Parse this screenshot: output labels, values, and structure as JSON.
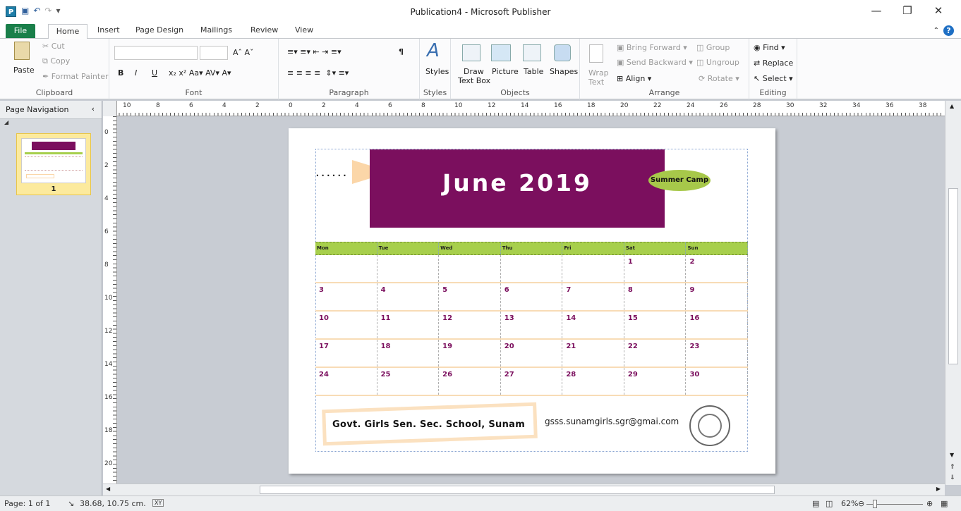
{
  "window": {
    "title": "Publication4  -  Microsoft Publisher",
    "app_icon": "P",
    "minimize": "—",
    "restore": "❐",
    "close": "✕"
  },
  "tabs": [
    "File",
    "Home",
    "Insert",
    "Page Design",
    "Mailings",
    "Review",
    "View"
  ],
  "ribbon": {
    "clipboard": {
      "paste": "Paste",
      "cut": "Cut",
      "copy": "Copy",
      "format_painter": "Format Painter",
      "label": "Clipboard"
    },
    "font": {
      "label": "Font",
      "bold": "B",
      "italic": "I",
      "underline": "U"
    },
    "paragraph": {
      "label": "Paragraph",
      "pilcrow": "¶"
    },
    "styles": {
      "styles": "Styles",
      "label": "Styles"
    },
    "objects": {
      "draw_text_box": "Draw",
      "draw_text_box2": "Text Box",
      "picture": "Picture",
      "table": "Table",
      "shapes": "Shapes",
      "label": "Objects"
    },
    "arrange": {
      "wrap_text": "Wrap",
      "wrap_text2": "Text",
      "bring_forward": "Bring Forward",
      "send_backward": "Send Backward",
      "align": "Align",
      "group": "Group",
      "ungroup": "Ungroup",
      "rotate": "Rotate",
      "label": "Arrange"
    },
    "editing": {
      "find": "Find",
      "replace": "Replace",
      "select": "Select",
      "label": "Editing"
    }
  },
  "page_nav": {
    "title": "Page Navigation",
    "page_number": "1"
  },
  "ruler_top": [
    "10",
    "8",
    "6",
    "4",
    "2",
    "0",
    "2",
    "4",
    "6",
    "8",
    "10",
    "12",
    "14",
    "16",
    "18",
    "20",
    "22",
    "24",
    "26",
    "28",
    "30",
    "32",
    "34",
    "36",
    "38"
  ],
  "ruler_left": [
    "0",
    "2",
    "4",
    "6",
    "8",
    "10",
    "12",
    "14",
    "16",
    "18",
    "20"
  ],
  "publication": {
    "banner_title": "June 2019",
    "badge": "Summer Camp",
    "dots": "......",
    "days": [
      "Mon",
      "Tue",
      "Wed",
      "Thu",
      "Fri",
      "Sat",
      "Sun"
    ],
    "weeks": [
      [
        "",
        "",
        "",
        "",
        "",
        "1",
        "2"
      ],
      [
        "3",
        "4",
        "5",
        "6",
        "7",
        "8",
        "9"
      ],
      [
        "10",
        "11",
        "12",
        "13",
        "14",
        "15",
        "16"
      ],
      [
        "17",
        "18",
        "19",
        "20",
        "21",
        "22",
        "23"
      ],
      [
        "24",
        "25",
        "26",
        "27",
        "28",
        "29",
        "30"
      ]
    ],
    "school": "Govt. Girls Sen. Sec. School, Sunam",
    "email": "gsss.sunamgirls.sgr@gmai.com"
  },
  "status": {
    "page": "Page: 1 of 1",
    "position": "38.68, 10.75 cm.",
    "zoom": "62%"
  },
  "colors": {
    "banner": "#7b0f5e",
    "accent_green": "#a7cf4c",
    "peach": "#fbd6a8",
    "file_tab": "#1a7f4a"
  }
}
